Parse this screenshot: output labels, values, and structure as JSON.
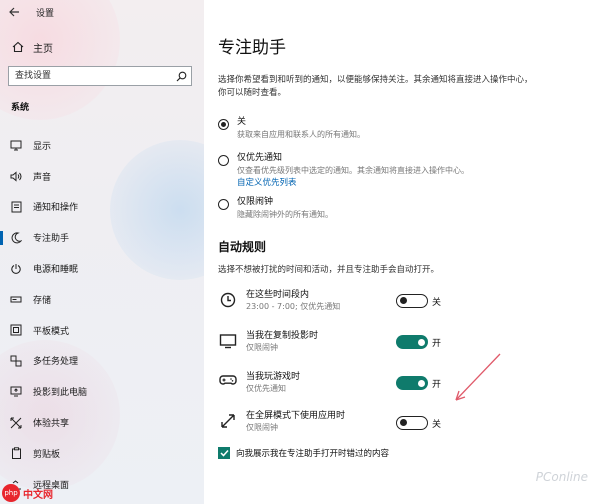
{
  "window": {
    "title": "设置",
    "back_icon": "back-arrow-icon"
  },
  "sidebar": {
    "home_label": "主页",
    "search_placeholder": "查找设置",
    "section_label": "系统",
    "items": [
      {
        "label": "显示",
        "icon": "display-icon"
      },
      {
        "label": "声音",
        "icon": "sound-icon"
      },
      {
        "label": "通知和操作",
        "icon": "notifications-icon"
      },
      {
        "label": "专注助手",
        "icon": "focus-assist-icon",
        "active": true
      },
      {
        "label": "电源和睡眠",
        "icon": "power-icon"
      },
      {
        "label": "存储",
        "icon": "storage-icon"
      },
      {
        "label": "平板模式",
        "icon": "tablet-icon"
      },
      {
        "label": "多任务处理",
        "icon": "multitasking-icon"
      },
      {
        "label": "投影到此电脑",
        "icon": "projecting-icon"
      },
      {
        "label": "体验共享",
        "icon": "shared-experiences-icon"
      },
      {
        "label": "剪贴板",
        "icon": "clipboard-icon"
      },
      {
        "label": "远程桌面",
        "icon": "remote-desktop-icon"
      }
    ]
  },
  "main": {
    "title": "专注助手",
    "description": "选择你希望看到和听到的通知，以便能够保持关注。其余通知将直接进入操作中心，你可以随时查看。",
    "options": [
      {
        "label": "关",
        "sub": "获取来自应用和联系人的所有通知。",
        "checked": true
      },
      {
        "label": "仅优先通知",
        "sub": "仅查看优先级列表中选定的通知。其余通知将直接进入操作中心。",
        "link": "自定义优先列表",
        "checked": false
      },
      {
        "label": "仅限闹钟",
        "sub": "隐藏除闹钟外的所有通知。",
        "checked": false
      }
    ],
    "rules_title": "自动规则",
    "rules_desc": "选择不想被打扰的时间和活动，并且专注助手会自动打开。",
    "rules": [
      {
        "title": "在这些时间段内",
        "sub": "23:00 - 7:00; 仅优先通知",
        "state": "关",
        "on": false,
        "icon": "clock-icon"
      },
      {
        "title": "当我在复制投影时",
        "sub": "仅限闹钟",
        "state": "开",
        "on": true,
        "icon": "monitor-icon"
      },
      {
        "title": "当我玩游戏时",
        "sub": "仅优先通知",
        "state": "开",
        "on": true,
        "icon": "gamepad-icon"
      },
      {
        "title": "在全屏模式下使用应用时",
        "sub": "仅限闹钟",
        "state": "关",
        "on": false,
        "icon": "fullscreen-icon"
      }
    ],
    "checkbox_label": "向我展示我在专注助手打开时错过的内容",
    "checkbox_checked": true
  },
  "watermarks": {
    "left": "中文网",
    "left_logo": "php",
    "right": "PConline"
  },
  "colors": {
    "accent": "#0063b1",
    "toggle_on": "#0f7b6c",
    "arrow": "#e05a6a"
  }
}
